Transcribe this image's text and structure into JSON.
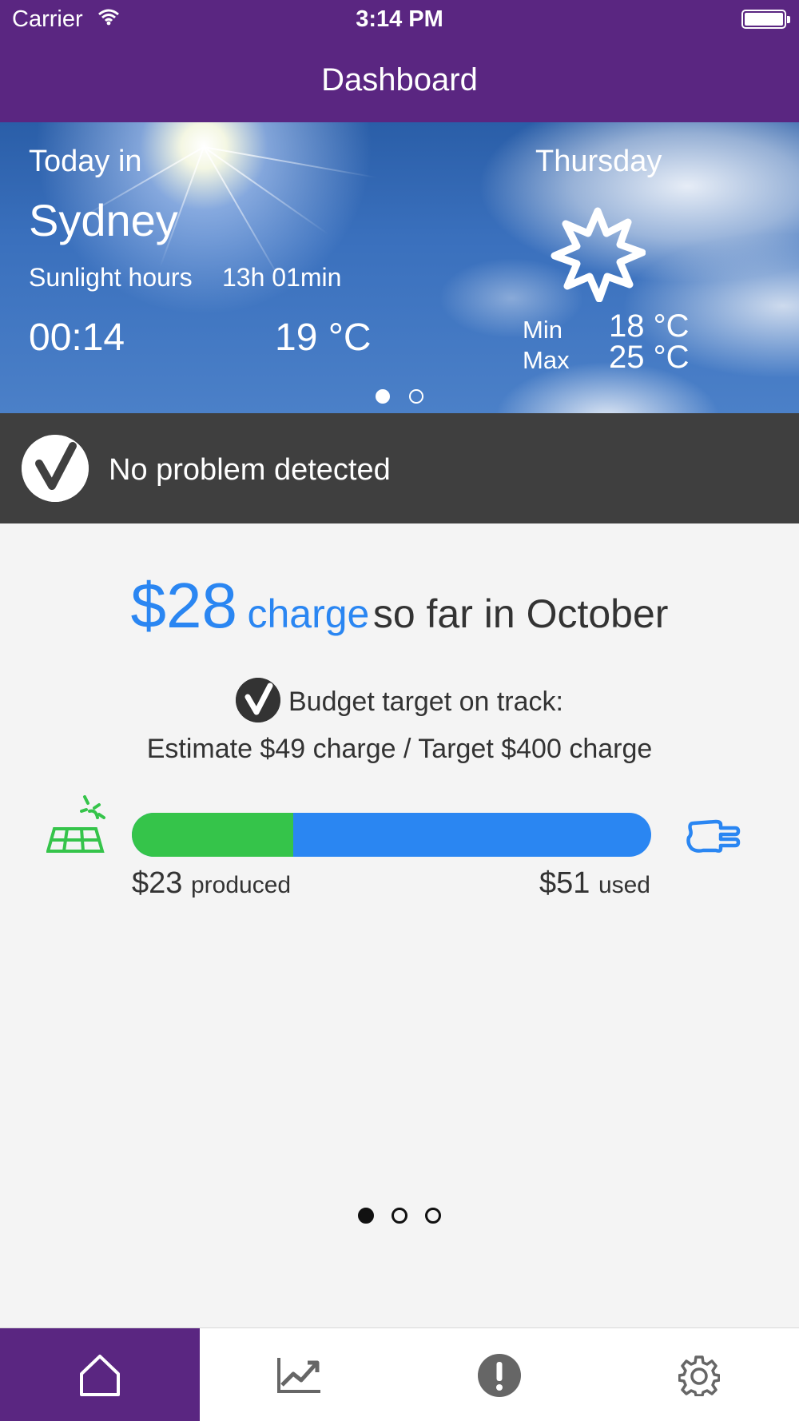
{
  "status_bar": {
    "carrier": "Carrier",
    "time": "3:14 PM"
  },
  "nav": {
    "title": "Dashboard"
  },
  "weather": {
    "today_label": "Today in",
    "city": "Sydney",
    "sunlight_label": "Sunlight hours",
    "sunlight_value": "13h 01min",
    "time": "00:14",
    "current_temp": "19 °C",
    "day": "Thursday",
    "icon": "sun-icon",
    "min_label": "Min",
    "min_value": "18 °C",
    "max_label": "Max",
    "max_value": "25 °C",
    "page_count": 2,
    "active_page": 0
  },
  "alert": {
    "icon": "check-circle-icon",
    "text": "No problem detected"
  },
  "summary": {
    "amount": "$28",
    "charge_word": "charge",
    "rest": "so far in October",
    "budget_text": "Budget target on track:",
    "estimate_text": "Estimate $49 charge / Target $400 charge"
  },
  "energy": {
    "produced_value": "$23",
    "produced_label": "produced",
    "used_value": "$51",
    "used_label": "used",
    "produced_fraction": 0.31,
    "colors": {
      "produced": "#35c44a",
      "used": "#2a86f2"
    },
    "left_icon": "solar-panel-icon",
    "right_icon": "plug-icon"
  },
  "pager": {
    "count": 3,
    "active": 0
  },
  "tabs": [
    {
      "name": "home",
      "icon": "home-icon",
      "active": true
    },
    {
      "name": "charts",
      "icon": "chart-icon",
      "active": false
    },
    {
      "name": "alerts",
      "icon": "alert-icon",
      "active": false
    },
    {
      "name": "settings",
      "icon": "gear-icon",
      "active": false
    }
  ],
  "colors": {
    "brand": "#5a2681",
    "accent": "#2a86f2",
    "alert_bg": "#3f3f3f"
  }
}
